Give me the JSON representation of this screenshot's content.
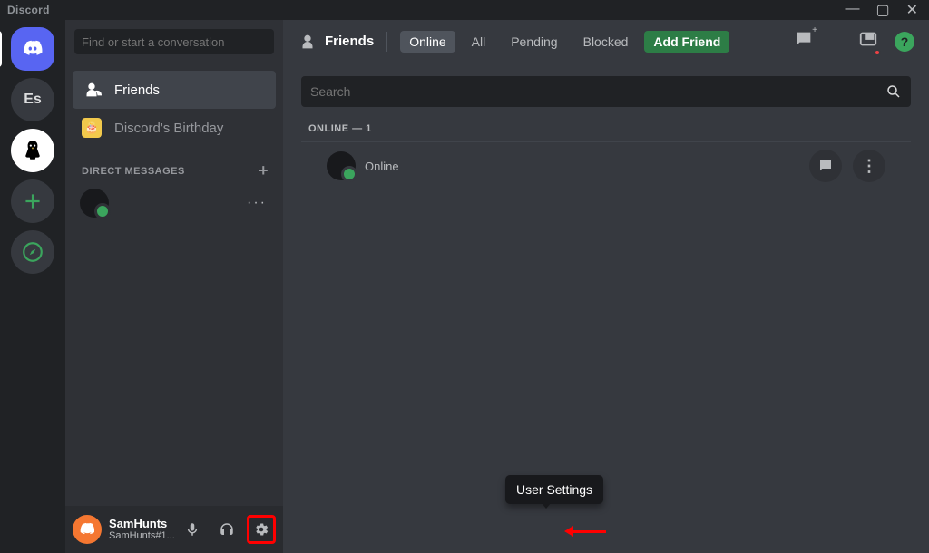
{
  "titlebar": {
    "app": "Discord"
  },
  "search": {
    "find_placeholder": "Find or start a conversation",
    "main_placeholder": "Search"
  },
  "nav": {
    "friends": "Friends",
    "birthday": "Discord's Birthday"
  },
  "dm": {
    "header": "DIRECT MESSAGES"
  },
  "top": {
    "friends": "Friends",
    "tabs": {
      "online": "Online",
      "all": "All",
      "pending": "Pending",
      "blocked": "Blocked"
    },
    "add_friend": "Add Friend"
  },
  "list": {
    "section": "ONLINE — 1",
    "status": "Online"
  },
  "user": {
    "name": "SamHunts",
    "tag": "SamHunts#1..."
  },
  "tooltip": {
    "settings": "User Settings"
  },
  "rail": {
    "es": "Es"
  }
}
